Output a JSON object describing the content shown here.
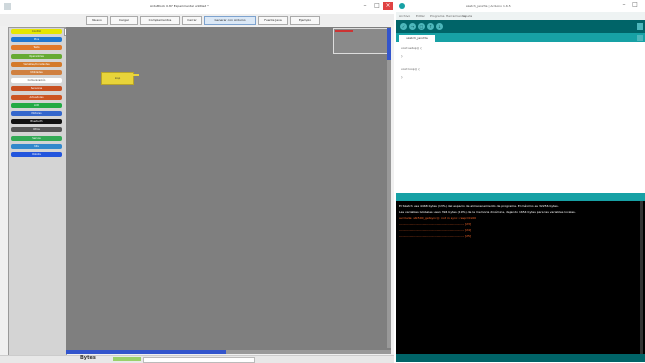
{
  "ardublock": {
    "title": "ArduBlock 0.87 Experimental untitled *",
    "toolbar": [
      {
        "label": "Nuevo",
        "active": false
      },
      {
        "label": "Cargar",
        "active": false
      },
      {
        "label": "Complementos",
        "active": false
      },
      {
        "label": "Cerrar",
        "active": false
      },
      {
        "label": "Generar con Arduino",
        "active": true
      },
      {
        "label": "Fuente Java",
        "active": false
      },
      {
        "label": "Ejemplo",
        "active": false
      }
    ],
    "palette": [
      {
        "label": "Control",
        "color": "#e6e600"
      },
      {
        "label": "Pins",
        "color": "#1f78d1"
      },
      {
        "label": "Tests",
        "color": "#e07a2a"
      },
      {
        "label": "Operadores",
        "color": "#66aa33"
      },
      {
        "label": "Variables/Constantes",
        "color": "#d47a2a"
      },
      {
        "label": "Utilidades",
        "color": "#d08040"
      },
      {
        "label": "Comunicación",
        "color": "#ffffff"
      },
      {
        "label": "Sensores",
        "color": "#c85020"
      },
      {
        "label": "Actuadores",
        "color": "#cc5522"
      },
      {
        "label": "LCD",
        "color": "#22aa44"
      },
      {
        "label": "Motores",
        "color": "#3366cc"
      },
      {
        "label": "Bluetooth",
        "color": "#111111"
      },
      {
        "label": "Otros",
        "color": "#555555"
      },
      {
        "label": "Servos",
        "color": "#33aa55"
      },
      {
        "label": "Kits",
        "color": "#3388cc"
      },
      {
        "label": "Robots",
        "color": "#2255dd"
      }
    ],
    "block_label": "loop",
    "status": {
      "text": "Bytes",
      "badge": ""
    }
  },
  "arduino": {
    "title": "sketch_jan23a | Arduino 1.6.5",
    "menu": [
      "Archivo",
      "Editar",
      "Programa",
      "Herramientas",
      "Ayuda"
    ],
    "tools": [
      "✓",
      "→",
      "□",
      "↑",
      "↓"
    ],
    "tab": "sketch_jan23a",
    "code": [
      "void setup() {",
      "",
      "}",
      "",
      "",
      "void loop() {",
      "",
      "}"
    ],
    "console": [
      {
        "text": "El Sketch usa 4468 bytes (13%) del espacio de almacenamiento de programa. El máximo es 32256 bytes.",
        "color": "#ffffff"
      },
      {
        "text": "Las variables Globales usan 394 bytes (19%) de la memoria dinámica, dejando 1654 bytes para las variables locales.",
        "color": "#ffffff"
      },
      {
        "text": "avrdude: stk500_getsync(): not in sync: resp=0x00",
        "color": "#ff6a2a"
      },
      {
        "text": "------------------------------------------------------------  [23]",
        "color": "#ff6a2a"
      },
      {
        "text": "------------------------------------------------------------  [24]",
        "color": "#ff6a2a"
      },
      {
        "text": "------------------------------------------------------------  [25]",
        "color": "#ff6a2a"
      }
    ]
  }
}
